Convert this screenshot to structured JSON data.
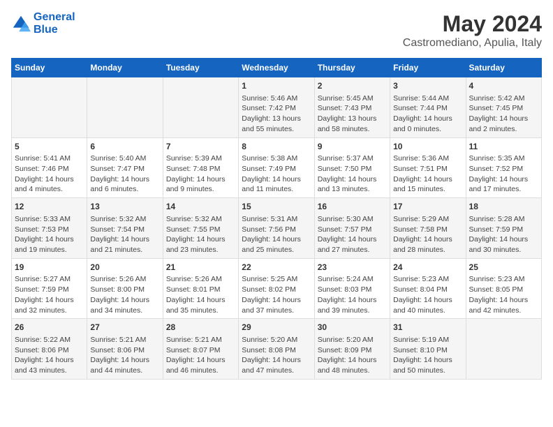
{
  "logo": {
    "line1": "General",
    "line2": "Blue"
  },
  "title": "May 2024",
  "subtitle": "Castromediano, Apulia, Italy",
  "days_of_week": [
    "Sunday",
    "Monday",
    "Tuesday",
    "Wednesday",
    "Thursday",
    "Friday",
    "Saturday"
  ],
  "weeks": [
    [
      {
        "day": "",
        "info": ""
      },
      {
        "day": "",
        "info": ""
      },
      {
        "day": "",
        "info": ""
      },
      {
        "day": "1",
        "info": "Sunrise: 5:46 AM\nSunset: 7:42 PM\nDaylight: 13 hours\nand 55 minutes."
      },
      {
        "day": "2",
        "info": "Sunrise: 5:45 AM\nSunset: 7:43 PM\nDaylight: 13 hours\nand 58 minutes."
      },
      {
        "day": "3",
        "info": "Sunrise: 5:44 AM\nSunset: 7:44 PM\nDaylight: 14 hours\nand 0 minutes."
      },
      {
        "day": "4",
        "info": "Sunrise: 5:42 AM\nSunset: 7:45 PM\nDaylight: 14 hours\nand 2 minutes."
      }
    ],
    [
      {
        "day": "5",
        "info": "Sunrise: 5:41 AM\nSunset: 7:46 PM\nDaylight: 14 hours\nand 4 minutes."
      },
      {
        "day": "6",
        "info": "Sunrise: 5:40 AM\nSunset: 7:47 PM\nDaylight: 14 hours\nand 6 minutes."
      },
      {
        "day": "7",
        "info": "Sunrise: 5:39 AM\nSunset: 7:48 PM\nDaylight: 14 hours\nand 9 minutes."
      },
      {
        "day": "8",
        "info": "Sunrise: 5:38 AM\nSunset: 7:49 PM\nDaylight: 14 hours\nand 11 minutes."
      },
      {
        "day": "9",
        "info": "Sunrise: 5:37 AM\nSunset: 7:50 PM\nDaylight: 14 hours\nand 13 minutes."
      },
      {
        "day": "10",
        "info": "Sunrise: 5:36 AM\nSunset: 7:51 PM\nDaylight: 14 hours\nand 15 minutes."
      },
      {
        "day": "11",
        "info": "Sunrise: 5:35 AM\nSunset: 7:52 PM\nDaylight: 14 hours\nand 17 minutes."
      }
    ],
    [
      {
        "day": "12",
        "info": "Sunrise: 5:33 AM\nSunset: 7:53 PM\nDaylight: 14 hours\nand 19 minutes."
      },
      {
        "day": "13",
        "info": "Sunrise: 5:32 AM\nSunset: 7:54 PM\nDaylight: 14 hours\nand 21 minutes."
      },
      {
        "day": "14",
        "info": "Sunrise: 5:32 AM\nSunset: 7:55 PM\nDaylight: 14 hours\nand 23 minutes."
      },
      {
        "day": "15",
        "info": "Sunrise: 5:31 AM\nSunset: 7:56 PM\nDaylight: 14 hours\nand 25 minutes."
      },
      {
        "day": "16",
        "info": "Sunrise: 5:30 AM\nSunset: 7:57 PM\nDaylight: 14 hours\nand 27 minutes."
      },
      {
        "day": "17",
        "info": "Sunrise: 5:29 AM\nSunset: 7:58 PM\nDaylight: 14 hours\nand 28 minutes."
      },
      {
        "day": "18",
        "info": "Sunrise: 5:28 AM\nSunset: 7:59 PM\nDaylight: 14 hours\nand 30 minutes."
      }
    ],
    [
      {
        "day": "19",
        "info": "Sunrise: 5:27 AM\nSunset: 7:59 PM\nDaylight: 14 hours\nand 32 minutes."
      },
      {
        "day": "20",
        "info": "Sunrise: 5:26 AM\nSunset: 8:00 PM\nDaylight: 14 hours\nand 34 minutes."
      },
      {
        "day": "21",
        "info": "Sunrise: 5:26 AM\nSunset: 8:01 PM\nDaylight: 14 hours\nand 35 minutes."
      },
      {
        "day": "22",
        "info": "Sunrise: 5:25 AM\nSunset: 8:02 PM\nDaylight: 14 hours\nand 37 minutes."
      },
      {
        "day": "23",
        "info": "Sunrise: 5:24 AM\nSunset: 8:03 PM\nDaylight: 14 hours\nand 39 minutes."
      },
      {
        "day": "24",
        "info": "Sunrise: 5:23 AM\nSunset: 8:04 PM\nDaylight: 14 hours\nand 40 minutes."
      },
      {
        "day": "25",
        "info": "Sunrise: 5:23 AM\nSunset: 8:05 PM\nDaylight: 14 hours\nand 42 minutes."
      }
    ],
    [
      {
        "day": "26",
        "info": "Sunrise: 5:22 AM\nSunset: 8:06 PM\nDaylight: 14 hours\nand 43 minutes."
      },
      {
        "day": "27",
        "info": "Sunrise: 5:21 AM\nSunset: 8:06 PM\nDaylight: 14 hours\nand 44 minutes."
      },
      {
        "day": "28",
        "info": "Sunrise: 5:21 AM\nSunset: 8:07 PM\nDaylight: 14 hours\nand 46 minutes."
      },
      {
        "day": "29",
        "info": "Sunrise: 5:20 AM\nSunset: 8:08 PM\nDaylight: 14 hours\nand 47 minutes."
      },
      {
        "day": "30",
        "info": "Sunrise: 5:20 AM\nSunset: 8:09 PM\nDaylight: 14 hours\nand 48 minutes."
      },
      {
        "day": "31",
        "info": "Sunrise: 5:19 AM\nSunset: 8:10 PM\nDaylight: 14 hours\nand 50 minutes."
      },
      {
        "day": "",
        "info": ""
      }
    ]
  ]
}
